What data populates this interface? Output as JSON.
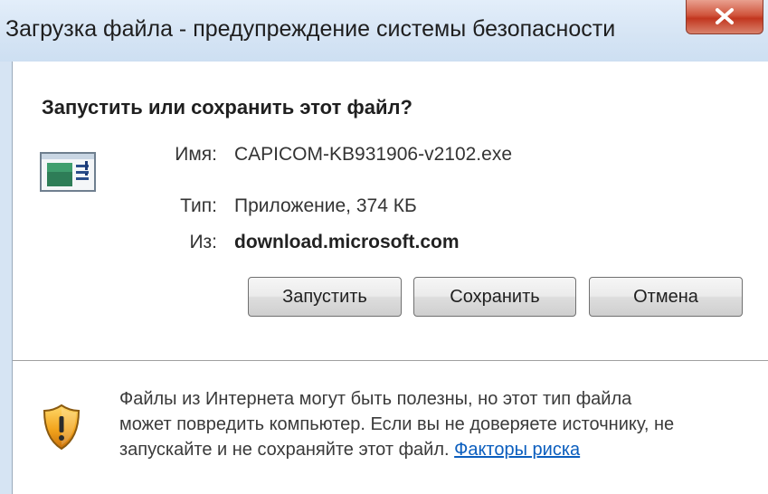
{
  "window": {
    "title": "Загрузка файла - предупреждение системы безопасности",
    "close_icon": "close-icon",
    "close_color": "#c7432a"
  },
  "dialog": {
    "heading": "Запустить или сохранить этот файл?",
    "file_icon": "application-window-icon",
    "fields": [
      {
        "label": "Имя:",
        "value": "CAPICOM-KB931906-v2102.exe"
      },
      {
        "label": "Тип:",
        "value": "Приложение, 374 КБ"
      },
      {
        "label": "Из:",
        "value": "download.microsoft.com"
      }
    ],
    "buttons": {
      "run": "Запустить",
      "save": "Сохранить",
      "cancel": "Отмена"
    }
  },
  "warning": {
    "icon": "security-shield-warning-icon",
    "line1": "Файлы из Интернета могут быть полезны, но этот тип файла",
    "line2": "может повредить компьютер. Если вы не доверяете источнику, не",
    "line3": "запускайте и не сохраняйте этот файл.",
    "link": "Факторы риска",
    "link_color": "#0b5ebe"
  }
}
